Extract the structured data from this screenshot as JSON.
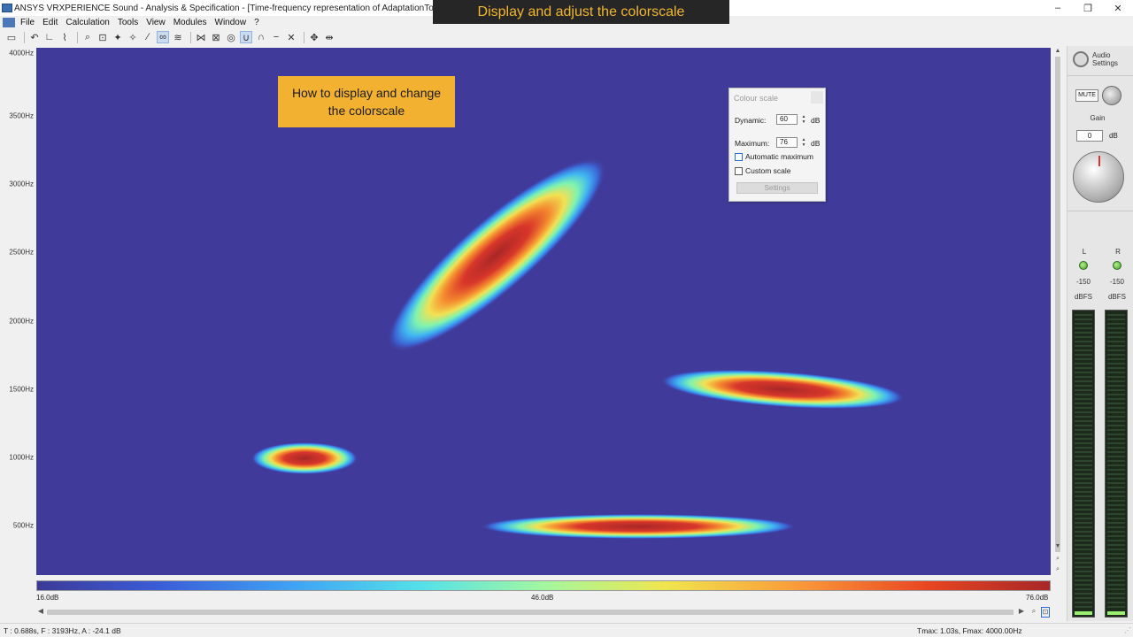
{
  "window": {
    "title": "ANSYS VRXPERIENCE Sound - Analysis & Specification - [Time-frequency representation of AdaptationTool_example (Ad",
    "controls": {
      "minimize": "–",
      "maximize": "❐",
      "close": "✕"
    }
  },
  "banner": {
    "text": "Display and adjust the colorscale"
  },
  "menu": {
    "items": [
      "File",
      "Edit",
      "Calculation",
      "Tools",
      "View",
      "Modules",
      "Window",
      "?"
    ]
  },
  "toolbar": {
    "icons": [
      "open-folder-icon",
      "undo-icon",
      "axes-icon",
      "lasso-icon",
      "zoom-icon",
      "zoom-region-icon",
      "pan-icon",
      "magic-wand-icon",
      "loop-icon",
      "waveform-icon",
      "cut-icon",
      "crosshair-icon",
      "union-icon",
      "intersection-icon",
      "minus-icon",
      "cross-icon",
      "move-icon"
    ]
  },
  "plot": {
    "yticks": [
      "4000Hz",
      "3500Hz",
      "3000Hz",
      "2500Hz",
      "2000Hz",
      "1500Hz",
      "1000Hz",
      "500Hz"
    ],
    "colorbar_ticks": [
      "16.0dB",
      "46.0dB",
      "76.0dB"
    ],
    "colors": {
      "background": "#403b9a"
    }
  },
  "callout": {
    "text": "How to display and change the colorscale"
  },
  "colour_scale_dialog": {
    "title": "Colour scale",
    "dynamic_label": "Dynamic:",
    "dynamic_value": "60",
    "dynamic_unit": "dB",
    "maximum_label": "Maximum:",
    "maximum_value": "76",
    "maximum_unit": "dB",
    "automatic_maximum_label": "Automatic maximum",
    "custom_scale_label": "Custom scale",
    "settings_button": "Settings"
  },
  "audio_panel": {
    "settings_label_1": "Audio",
    "settings_label_2": "Settings",
    "mute_label": "MUTE",
    "gain_label": "Gain",
    "gain_value": "0",
    "gain_unit": "dB",
    "left_label": "L",
    "right_label": "R",
    "left_value": "-150",
    "right_value": "-150",
    "left_unit": "dBFS",
    "right_unit": "dBFS"
  },
  "status": {
    "left": "T : 0.688s, F : 3193Hz, A : -24.1 dB",
    "right": "Tmax: 1.03s, Fmax: 4000.00Hz"
  }
}
